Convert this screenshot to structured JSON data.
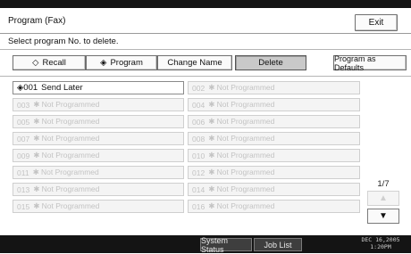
{
  "window": {
    "title": "Program (Fax)",
    "exit_label": "Exit"
  },
  "instruction": "Select program No. to delete.",
  "toolbar": {
    "recall_label": "Recall",
    "recall_icon": "◇",
    "program_label": "Program",
    "program_icon": "◈",
    "change_name_label": "Change Name",
    "delete_label": "Delete",
    "program_as_defaults_label": "Program as Defaults"
  },
  "programs": [
    {
      "prefix": "◈001",
      "label": "Send Later"
    },
    {
      "prefix": "002",
      "label": "✱ Not Programmed"
    },
    {
      "prefix": "003",
      "label": "✱ Not Programmed"
    },
    {
      "prefix": "004",
      "label": "✱ Not Programmed"
    },
    {
      "prefix": "005",
      "label": "✱ Not Programmed"
    },
    {
      "prefix": "006",
      "label": "✱ Not Programmed"
    },
    {
      "prefix": "007",
      "label": "✱ Not Programmed"
    },
    {
      "prefix": "008",
      "label": "✱ Not Programmed"
    },
    {
      "prefix": "009",
      "label": "✱ Not Programmed"
    },
    {
      "prefix": "010",
      "label": "✱ Not Programmed"
    },
    {
      "prefix": "011",
      "label": "✱ Not Programmed"
    },
    {
      "prefix": "012",
      "label": "✱ Not Programmed"
    },
    {
      "prefix": "013",
      "label": "✱ Not Programmed"
    },
    {
      "prefix": "014",
      "label": "✱ Not Programmed"
    },
    {
      "prefix": "015",
      "label": "✱ Not Programmed"
    },
    {
      "prefix": "016",
      "label": "✱ Not Programmed"
    }
  ],
  "pagination": {
    "page": "1/7",
    "up_icon": "▲",
    "down_icon": "▼"
  },
  "statusbar": {
    "system_status_label": "System Status",
    "job_list_label": "Job List",
    "date": "DEC  16,2005",
    "time": "1:20PM"
  }
}
